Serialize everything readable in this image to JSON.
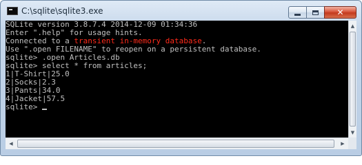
{
  "window": {
    "title": "C:\\sqlite\\sqlite3.exe",
    "icons": {
      "app": "console-icon",
      "minimize": "minimize-icon",
      "maximize": "maximize-icon",
      "close": "close-icon"
    },
    "close_glyph": "✕"
  },
  "console": {
    "colors": {
      "text": "#c0c0c0",
      "background": "#000000",
      "highlight": "#ff2a1a"
    },
    "lines": {
      "l0": "SQLite version 3.8.7.4 2014-12-09 01:34:36",
      "l1": "Enter \".help\" for usage hints.",
      "l2_before": "Connected to a ",
      "l2_highlight": "transient in-memory database",
      "l2_after": ".",
      "l3": "Use \".open FILENAME\" to reopen on a persistent database.",
      "l4": "sqlite> .open Articles.db",
      "l5": "sqlite> select * from articles;",
      "l6": "1|T-Shirt|25.0",
      "l7": "2|Socks|2.3",
      "l8": "3|Pants|34.0",
      "l9": "4|Jacket|57.5",
      "l10": "sqlite> "
    }
  },
  "scrollbars": {
    "up_arrow": "▲",
    "down_arrow": "▼",
    "left_arrow": "◀",
    "right_arrow": "▶"
  }
}
